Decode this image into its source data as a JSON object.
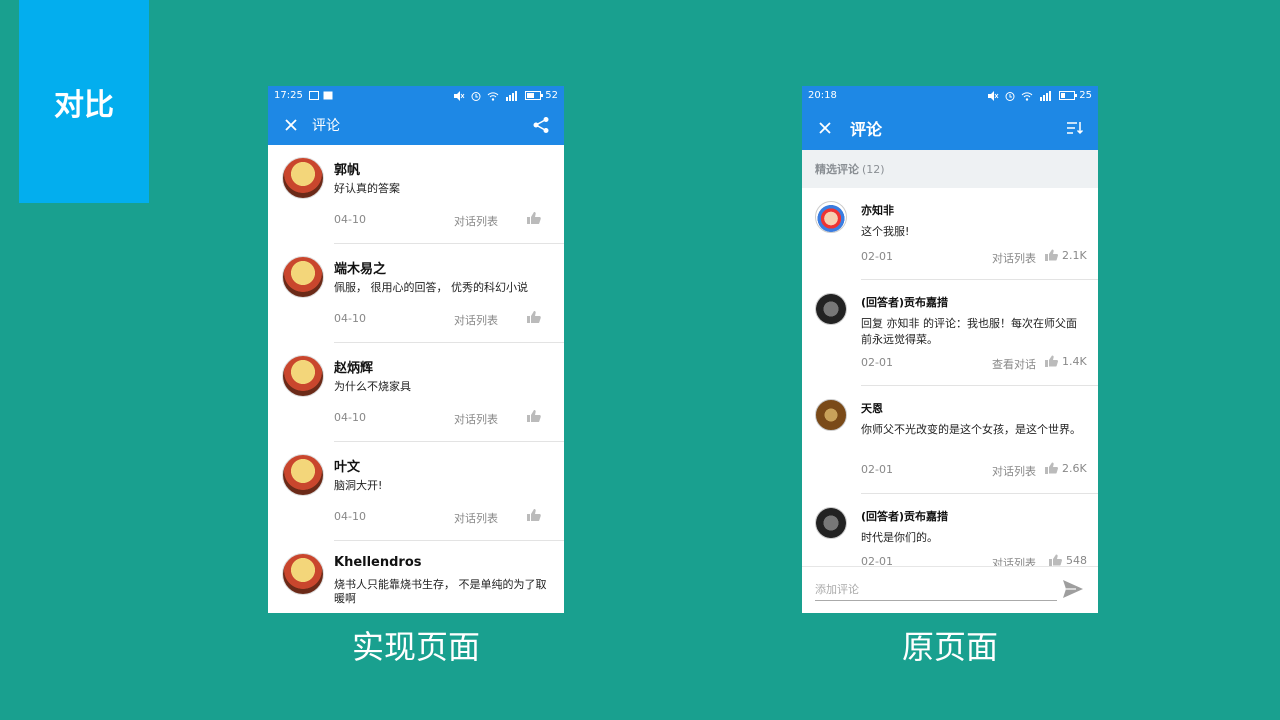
{
  "badge": "对比",
  "colors": {
    "background": "#19a08f",
    "badge": "#03aeee",
    "appbar": "#1e88e5"
  },
  "left_phone": {
    "caption": "实现页面",
    "status": {
      "time": "17:25",
      "battery": "52"
    },
    "title": "评论",
    "comments": [
      {
        "name": "郭帆",
        "text": "好认真的答案",
        "date": "04-10",
        "dialog": "对话列表"
      },
      {
        "name": "端木易之",
        "text": "佩服， 很用心的回答， 优秀的科幻小说",
        "date": "04-10",
        "dialog": "对话列表"
      },
      {
        "name": "赵炳辉",
        "text": "为什么不烧家具",
        "date": "04-10",
        "dialog": "对话列表"
      },
      {
        "name": "叶文",
        "text": "脑洞大开!",
        "date": "04-10",
        "dialog": "对话列表"
      },
      {
        "name": "Khellendros",
        "text": "烧书人只能靠烧书生存， 不是单纯的为了取暖啊",
        "date": "",
        "dialog": ""
      }
    ]
  },
  "right_phone": {
    "caption": "原页面",
    "status": {
      "time": "20:18",
      "battery": "25"
    },
    "title": "评论",
    "section": {
      "label": "精选评论",
      "count": "(12)"
    },
    "comments": [
      {
        "name": "亦知非",
        "text": "这个我服!",
        "date": "02-01",
        "dialog": "对话列表",
        "likes": "2.1K"
      },
      {
        "name": "(回答者)贡布嘉措",
        "text": "回复 亦知非 的评论：我也服！每次在师父面前永远觉得菜。",
        "date": "02-01",
        "dialog": "查看对话",
        "likes": "1.4K"
      },
      {
        "name": "天恩",
        "text": "你师父不光改变的是这个女孩，是这个世界。",
        "date": "02-01",
        "dialog": "对话列表",
        "likes": "2.6K"
      },
      {
        "name": "(回答者)贡布嘉措",
        "text": "时代是你们的。",
        "date": "02-01",
        "dialog": "对话列表",
        "likes": "548"
      }
    ],
    "input_placeholder": "添加评论"
  }
}
